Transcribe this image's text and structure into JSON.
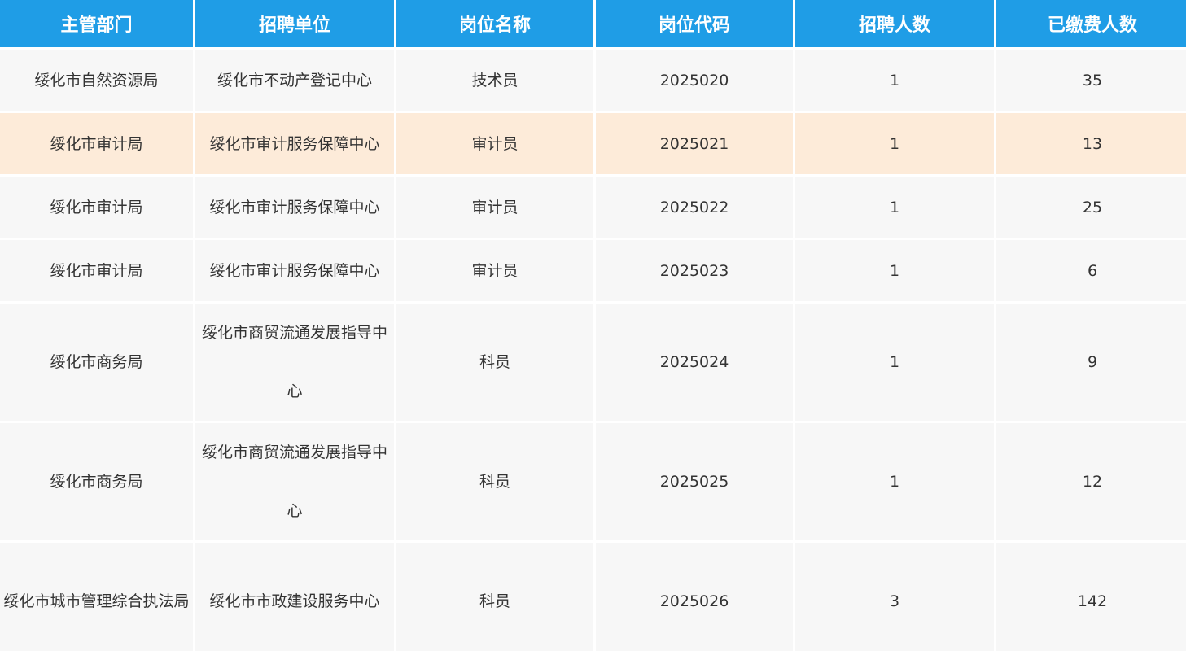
{
  "columns": [
    "主管部门",
    "招聘单位",
    "岗位名称",
    "岗位代码",
    "招聘人数",
    "已缴费人数"
  ],
  "rows": [
    {
      "dept": "绥化市自然资源局",
      "unit": "绥化市不动产登记中心",
      "position": "技术员",
      "code": "2025020",
      "openings": "1",
      "paid": "35"
    },
    {
      "dept": "绥化市审计局",
      "unit": "绥化市审计服务保障中心",
      "position": "审计员",
      "code": "2025021",
      "openings": "1",
      "paid": "13"
    },
    {
      "dept": "绥化市审计局",
      "unit": "绥化市审计服务保障中心",
      "position": "审计员",
      "code": "2025022",
      "openings": "1",
      "paid": "25"
    },
    {
      "dept": "绥化市审计局",
      "unit": "绥化市审计服务保障中心",
      "position": "审计员",
      "code": "2025023",
      "openings": "1",
      "paid": "6"
    },
    {
      "dept": "绥化市商务局",
      "unit": "绥化市商贸流通发展指导中心",
      "position": "科员",
      "code": "2025024",
      "openings": "1",
      "paid": "9"
    },
    {
      "dept": "绥化市商务局",
      "unit": "绥化市商贸流通发展指导中心",
      "position": "科员",
      "code": "2025025",
      "openings": "1",
      "paid": "12"
    },
    {
      "dept": "绥化市城市管理综合执法局",
      "unit": "绥化市市政建设服务中心",
      "position": "科员",
      "code": "2025026",
      "openings": "3",
      "paid": "142"
    }
  ],
  "colors": {
    "header_bg": "#1f9de6",
    "row_bg": "#f7f7f7",
    "highlight_bg": "#fdebd9"
  }
}
